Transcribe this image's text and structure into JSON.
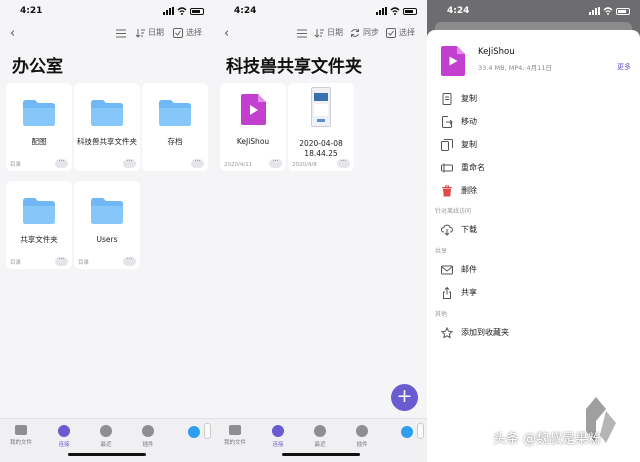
{
  "panel1": {
    "time": "4:21",
    "tools": {
      "date": "日期",
      "select": "选择"
    },
    "title": "办公室",
    "items": [
      {
        "label": "配图",
        "meta": "目录"
      },
      {
        "label": "科技兽共享文件夹",
        "meta": ""
      },
      {
        "label": "存档",
        "meta": ""
      },
      {
        "label": "共享文件夹",
        "meta": "目录"
      },
      {
        "label": "Users",
        "meta": "目录"
      }
    ]
  },
  "panel2": {
    "time": "4:24",
    "tools": {
      "date": "日期",
      "sync": "同步",
      "select": "选择"
    },
    "title": "科技兽共享文件夹",
    "items": [
      {
        "label": "KeJiShou",
        "meta": "2020/4/11"
      },
      {
        "label": "2020-04-08 18.44.25",
        "meta": "2020/4/8"
      }
    ]
  },
  "tabs": [
    {
      "label": "我的文件"
    },
    {
      "label": "连接"
    },
    {
      "label": "最近"
    },
    {
      "label": "插件"
    }
  ],
  "panel3": {
    "time": "4:24",
    "file": {
      "name": "KeJiShou",
      "meta": "33.4 MB, MP4, 4月11日",
      "more": "更多"
    },
    "actions": [
      {
        "label": "复制",
        "icon": "copy-icon"
      },
      {
        "label": "移动",
        "icon": "move-icon"
      },
      {
        "label": "复制",
        "icon": "duplicate-icon"
      },
      {
        "label": "重命名",
        "icon": "rename-icon"
      },
      {
        "label": "删除",
        "icon": "trash-icon"
      }
    ],
    "offline": {
      "header": "针对离线访问",
      "items": [
        {
          "label": "下载",
          "icon": "download-icon"
        }
      ]
    },
    "share": {
      "header": "共享",
      "items": [
        {
          "label": "邮件",
          "icon": "mail-icon"
        },
        {
          "label": "共享",
          "icon": "share-icon"
        }
      ]
    },
    "other": {
      "header": "其他",
      "items": [
        {
          "label": "添加到收藏夹",
          "icon": "star-icon"
        }
      ]
    }
  },
  "watermark": "头条 @魏叔是果粉",
  "colors": {
    "accent": "#6a5bd2",
    "folder": "#6fb8f5",
    "video": "#c23fd0",
    "danger": "#e0494a"
  }
}
